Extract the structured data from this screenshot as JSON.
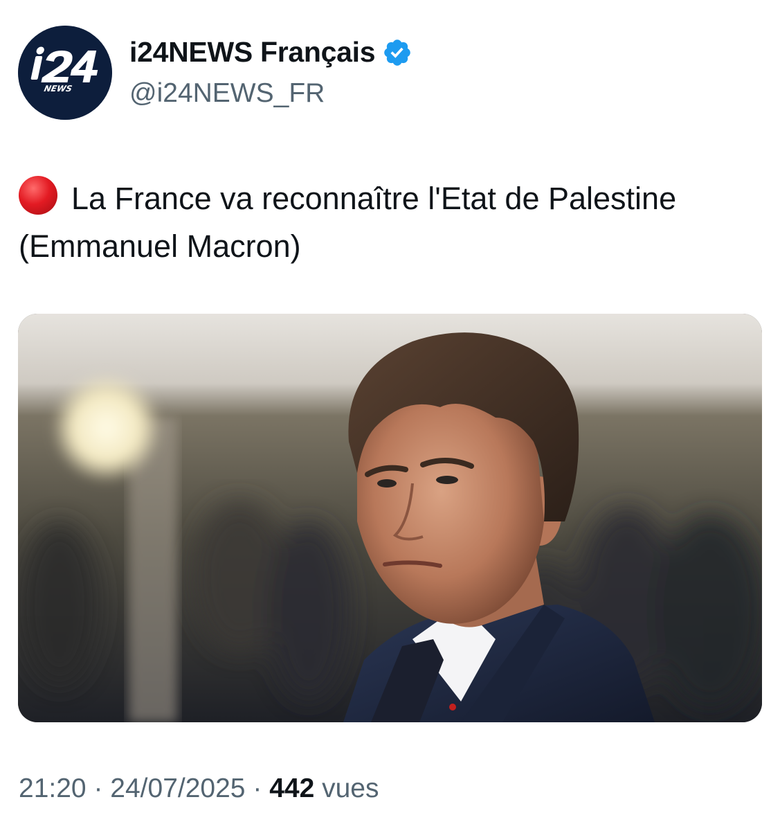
{
  "account": {
    "display_name": "i24NEWS Français",
    "handle": "@i24NEWS_FR",
    "verified": true,
    "avatar_logo_text": "i24",
    "avatar_logo_subtext": "NEWS",
    "avatar_bg_color": "#0d1e3c"
  },
  "tweet": {
    "emoji": "red-circle-icon",
    "text": "La France va reconnaître l'Etat de Palestine (Emmanuel Macron)"
  },
  "footer": {
    "time": "21:20",
    "separator": "·",
    "date": "24/07/2025",
    "views_count": "442",
    "views_label": "vues"
  },
  "colors": {
    "verified_badge": "#1d9bf0",
    "secondary_text": "#536471",
    "primary_text": "#0f1419",
    "red_circle": "#e31b23"
  }
}
